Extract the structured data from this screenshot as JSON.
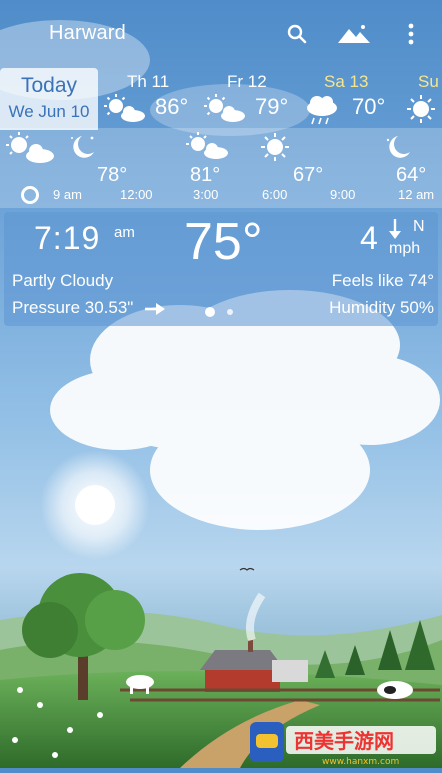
{
  "header": {
    "city": "Harward",
    "icons": [
      "search-icon",
      "landscape-icon",
      "overflow-menu-icon"
    ]
  },
  "daily": {
    "today_label": "Today",
    "today_date": "We Jun 10",
    "days": [
      {
        "name": "Th 11",
        "temp": "86°",
        "icon": "sun-cloud-icon",
        "color": "#ffffff"
      },
      {
        "name": "Fr 12",
        "temp": "79°",
        "icon": "sun-cloud-icon",
        "color": "#ffffff"
      },
      {
        "name": "Sa 13",
        "temp": "70°",
        "icon": "rain-cloud-icon",
        "color": "#f6e58d"
      },
      {
        "name": "Su",
        "temp": "",
        "icon": "sun-icon",
        "color": "#f6e58d"
      }
    ]
  },
  "hourly": {
    "items": [
      {
        "time": "9 am",
        "temp": "",
        "icon": "sun-cloud-icon"
      },
      {
        "time": "12:00",
        "temp": "78°",
        "icon": "moon-icon"
      },
      {
        "time": "3:00",
        "temp": "81°",
        "icon": "sun-cloud-icon"
      },
      {
        "time": "6:00",
        "temp": "67°",
        "icon": "sun-icon"
      },
      {
        "time": "9:00",
        "temp": "",
        "icon": ""
      },
      {
        "time": "12 am",
        "temp": "64°",
        "icon": "moon-icon"
      }
    ]
  },
  "current": {
    "time": "7:19",
    "ampm": "am",
    "temperature": "75°",
    "wind_speed": "4",
    "wind_dir": "N",
    "wind_unit": "mph",
    "condition": "Partly Cloudy",
    "feels_like": "Feels like 74°",
    "pressure": "Pressure 30.53\"",
    "humidity": "Humidity 50%",
    "page_dots": 2
  },
  "watermark": {
    "text": "西美手游网",
    "url": "www.hanxm.com"
  },
  "colors": {
    "accent": "#3a73b8",
    "card": "#5c96d2"
  }
}
